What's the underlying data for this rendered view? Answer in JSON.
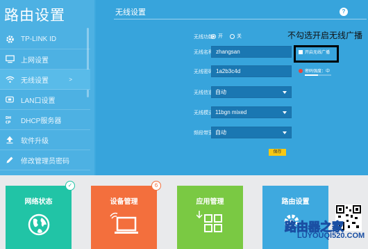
{
  "sidebar": {
    "title": "路由设置",
    "items": [
      {
        "label": "TP-LINK ID",
        "icon": "gear-icon"
      },
      {
        "label": "上网设置",
        "icon": "monitor-icon"
      },
      {
        "label": "无线设置",
        "icon": "wifi-icon",
        "arrow": ">"
      },
      {
        "label": "LAN口设置",
        "icon": "lan-icon"
      },
      {
        "label": "DHCP服务器",
        "icon": "dhcp-icon"
      },
      {
        "label": "软件升级",
        "icon": "upload-icon"
      },
      {
        "label": "修改管理员密码",
        "icon": "pencil-icon"
      }
    ]
  },
  "main": {
    "title": "无线设置",
    "help": "?",
    "fields": {
      "wireless_function": {
        "label": "无线功能",
        "on": "开",
        "off": "关",
        "selected": "开"
      },
      "ssid": {
        "label": "无线名称",
        "value": "zhangsan"
      },
      "hide_ssid": {
        "label": "开启无线广播",
        "checked": false
      },
      "password": {
        "label": "无线密码",
        "value": "1a2b3c4d"
      },
      "strength": {
        "label": "密码强度：中",
        "level": 0.5
      },
      "channel": {
        "label": "无线信道",
        "value": "自动"
      },
      "mode": {
        "label": "无线模式",
        "value": "11bgn mixed"
      },
      "bandwidth": {
        "label": "频段带宽",
        "value": "自动"
      }
    },
    "save_label": "保存",
    "annotation": "不勾选开启无线广播"
  },
  "tiles": [
    {
      "label": "网络状态",
      "color": "#21c4a6",
      "badge": "✓"
    },
    {
      "label": "设备管理",
      "color": "#f36f3d",
      "badge": "6"
    },
    {
      "label": "应用管理",
      "color": "#7ac943"
    },
    {
      "label": "路由设置",
      "color": "#3ea9df"
    }
  ],
  "watermark": {
    "main": "路由器之家",
    "sub": "LUYOUQI520.COM"
  },
  "colors": {
    "accent": "#3ea9df",
    "save": "#f7c812"
  }
}
